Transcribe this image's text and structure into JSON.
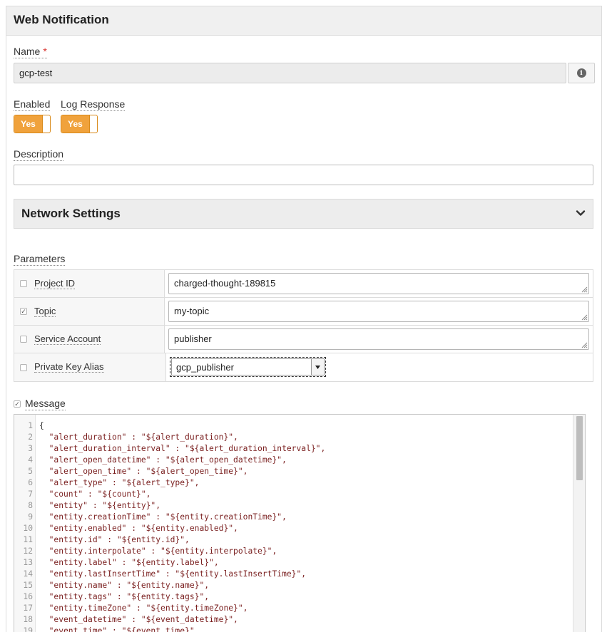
{
  "panel": {
    "title": "Web Notification"
  },
  "name_field": {
    "label": "Name",
    "required_mark": "*",
    "value": "gcp-test",
    "info_icon": "info-icon"
  },
  "enabled": {
    "label": "Enabled",
    "value": "Yes"
  },
  "log_response": {
    "label": "Log Response",
    "value": "Yes"
  },
  "description": {
    "label": "Description",
    "value": ""
  },
  "network_settings": {
    "title": "Network Settings",
    "icon": "chevron-down-icon"
  },
  "parameters": {
    "label": "Parameters",
    "rows": [
      {
        "name": "Project ID",
        "checked": false,
        "value": "charged-thought-189815",
        "kind": "text"
      },
      {
        "name": "Topic",
        "checked": true,
        "value": "my-topic",
        "kind": "text"
      },
      {
        "name": "Service Account",
        "checked": false,
        "value": "publisher",
        "kind": "text"
      },
      {
        "name": "Private Key Alias",
        "checked": false,
        "value": "gcp_publisher",
        "kind": "select"
      }
    ]
  },
  "message": {
    "label": "Message",
    "checked": true,
    "lines": [
      "{",
      "  \"alert_duration\" : \"${alert_duration}\",",
      "  \"alert_duration_interval\" : \"${alert_duration_interval}\",",
      "  \"alert_open_datetime\" : \"${alert_open_datetime}\",",
      "  \"alert_open_time\" : \"${alert_open_time}\",",
      "  \"alert_type\" : \"${alert_type}\",",
      "  \"count\" : \"${count}\",",
      "  \"entity\" : \"${entity}\",",
      "  \"entity.creationTime\" : \"${entity.creationTime}\",",
      "  \"entity.enabled\" : \"${entity.enabled}\",",
      "  \"entity.id\" : \"${entity.id}\",",
      "  \"entity.interpolate\" : \"${entity.interpolate}\",",
      "  \"entity.label\" : \"${entity.label}\",",
      "  \"entity.lastInsertTime\" : \"${entity.lastInsertTime}\",",
      "  \"entity.name\" : \"${entity.name}\",",
      "  \"entity.tags\" : \"${entity.tags}\",",
      "  \"entity.timeZone\" : \"${entity.timeZone}\",",
      "  \"event_datetime\" : \"${event_datetime}\",",
      "  \"event_time\" : \"${event_time}\","
    ]
  },
  "colors": {
    "accent": "#f0a23c",
    "required": "#d9302c",
    "code_string": "#7a1f1f"
  }
}
